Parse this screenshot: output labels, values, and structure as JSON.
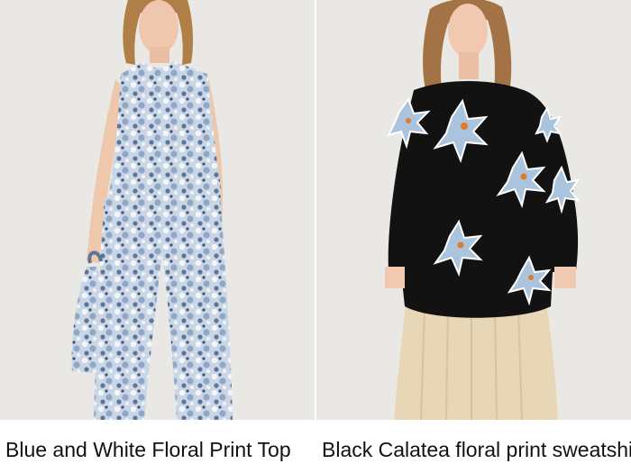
{
  "products": [
    {
      "name": "Blue and White Floral Print Top",
      "image_description": "Sleeveless floral print top with matching wide-leg trousers and bag"
    },
    {
      "name": "Black Calatea floral print sweatshirt",
      "image_description": "Black sweatshirt with blue calatea flowers and cream pleated skirt"
    }
  ],
  "colors": {
    "background": "#eae8e5",
    "text": "#111111",
    "floral_blue": "#a9c4dc",
    "sweatshirt_black": "#121212",
    "skirt_cream": "#e7d7b6"
  }
}
